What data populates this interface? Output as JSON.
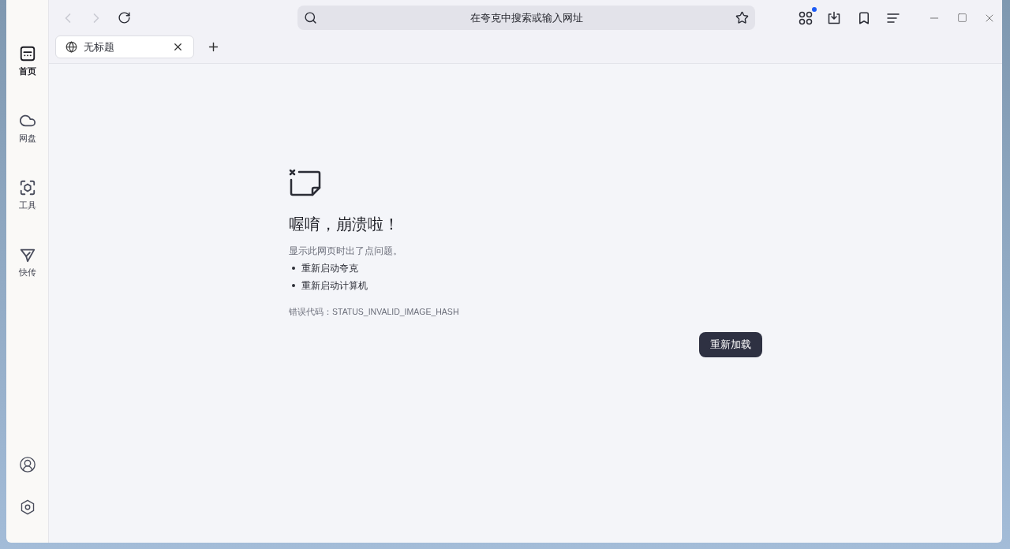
{
  "nav": {
    "back": {
      "disabled": true
    },
    "forward": {
      "disabled": true
    }
  },
  "address_bar": {
    "placeholder": "在夸克中搜索或输入网址"
  },
  "toolbar": {
    "apps_notification": true
  },
  "tabs": [
    {
      "title": "无标题",
      "selected": true
    }
  ],
  "sidebar": {
    "items": [
      {
        "label": "首页",
        "selected": true
      },
      {
        "label": "网盘",
        "selected": false
      },
      {
        "label": "工具",
        "selected": false
      },
      {
        "label": "快传",
        "selected": false
      }
    ]
  },
  "error_page": {
    "title": "喔唷，崩溃啦！",
    "message": "显示此网页时出了点问题。",
    "suggestions": [
      "重新启动夸克",
      "重新启动计算机"
    ],
    "error_code": "错误代码：STATUS_INVALID_IMAGE_HASH",
    "button": "重新加载"
  }
}
